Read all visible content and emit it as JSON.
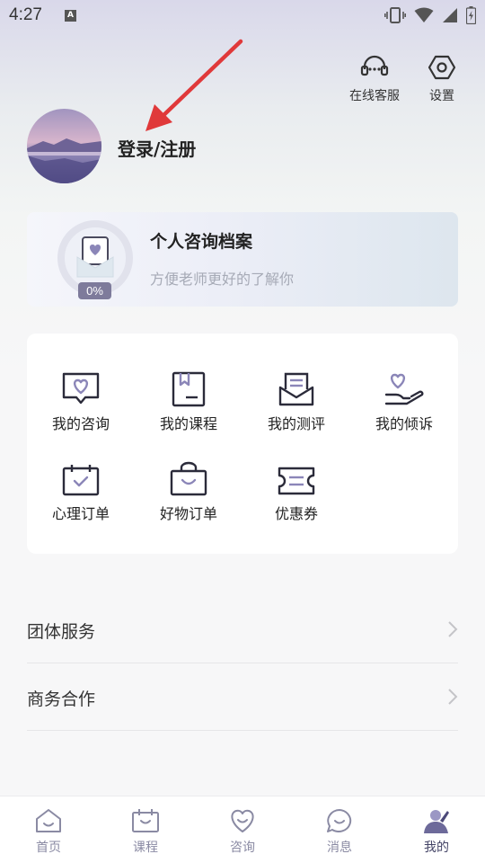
{
  "status_bar": {
    "time": "4:27",
    "notification": "A"
  },
  "header": {
    "customer_service_label": "在线客服",
    "settings_label": "设置"
  },
  "user": {
    "login_label": "登录/注册"
  },
  "profile_card": {
    "title": "个人咨询档案",
    "subtitle": "方便老师更好的了解你",
    "progress_text": "0%",
    "progress": 0
  },
  "menu": {
    "items": [
      {
        "label": "我的咨询",
        "icon": "consult-icon"
      },
      {
        "label": "我的课程",
        "icon": "course-icon"
      },
      {
        "label": "我的测评",
        "icon": "assessment-icon"
      },
      {
        "label": "我的倾诉",
        "icon": "confide-icon"
      },
      {
        "label": "心理订单",
        "icon": "psych-order-icon"
      },
      {
        "label": "好物订单",
        "icon": "goods-order-icon"
      },
      {
        "label": "优惠券",
        "icon": "coupon-icon"
      }
    ]
  },
  "list": {
    "items": [
      {
        "label": "团体服务"
      },
      {
        "label": "商务合作"
      }
    ]
  },
  "tabbar": {
    "items": [
      {
        "label": "首页",
        "icon": "home-icon"
      },
      {
        "label": "课程",
        "icon": "course-tab-icon"
      },
      {
        "label": "咨询",
        "icon": "consult-tab-icon"
      },
      {
        "label": "消息",
        "icon": "message-icon"
      },
      {
        "label": "我的",
        "icon": "profile-icon"
      }
    ],
    "active": "我的"
  },
  "colors": {
    "accent": "#7e7b9b",
    "icon_stroke": "#2b2b3a",
    "icon_fill": "#8b86b8",
    "tab_inactive": "#8a8aa3",
    "arrow": "#e0393a"
  }
}
